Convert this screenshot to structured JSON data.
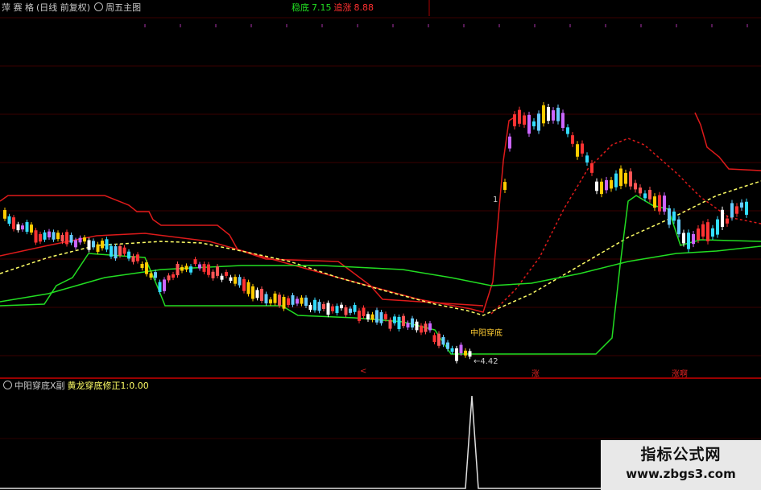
{
  "header": {
    "stock_name": "萍 赛 格",
    "period": "(日线 前复权)",
    "indicator": "周五主图"
  },
  "values": {
    "support_label": "稳底",
    "support_value": "7.15",
    "pressure_label": "追涨",
    "pressure_value": "8.88"
  },
  "price_labels": {
    "low_price": "4.42",
    "tick": "1",
    "buy_signal": "中阳穿底"
  },
  "markers": [
    "<",
    "涨",
    "涨啊"
  ],
  "sub_header": {
    "name": "中阳穿底X副",
    "formula": "黄龙穿底修正1:0.00"
  },
  "watermark": {
    "title": "指标公式网",
    "url": "www.zbgs3.com"
  },
  "colors": {
    "background": "#000000",
    "red_line": "#ff2020",
    "green_line": "#22dd22",
    "yellow_line": "#ffff66",
    "separator": "#cc0000"
  }
}
